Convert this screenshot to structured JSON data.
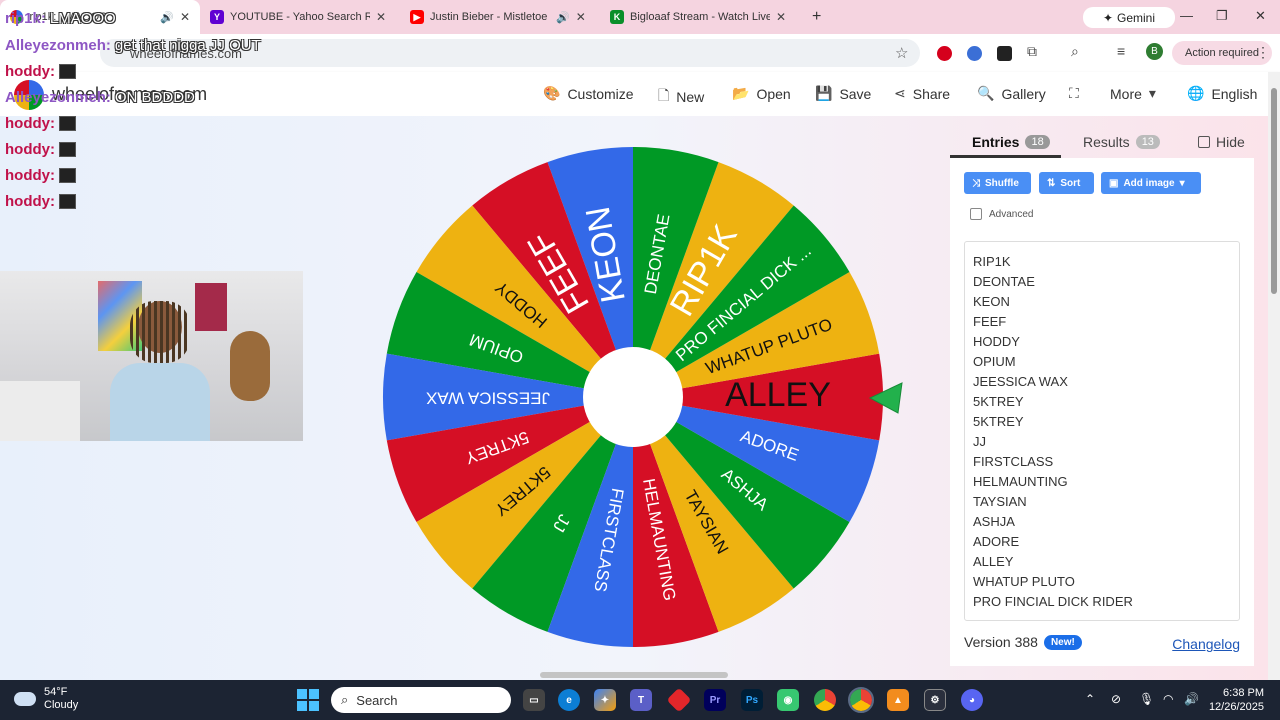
{
  "browser": {
    "tabs": [
      {
        "title": "rip1k: LMAOOO",
        "favicon": "wheel-icon"
      },
      {
        "title": "YOUTUBE - Yahoo Search Results",
        "favicon": "yahoo-icon"
      },
      {
        "title": "Justin Bieber - Mistletoe (Lyrics)",
        "favicon": "youtube-icon"
      },
      {
        "title": "Bigloaaf Stream - Watch Live on Kick",
        "favicon": "kick-icon"
      }
    ],
    "gemini_label": "Gemini",
    "url": "wheelofnames.com",
    "action_required": "Action required",
    "profile_initial": "B"
  },
  "site": {
    "name": "wheelofnames.com",
    "nav": [
      "Customize",
      "New",
      "Open",
      "Save",
      "Share",
      "Gallery",
      "More",
      "English"
    ]
  },
  "wheel": {
    "colors": [
      "#3369e8",
      "#d50f25",
      "#eeb211",
      "#009925"
    ],
    "segments": [
      "RIP1K",
      "DEONTAE",
      "KEON",
      "FEEF",
      "HODDY",
      "OPIUM",
      "JEESSICA WAX",
      "5KTREY",
      "5KTREY",
      "JJ",
      "FIRSTCLASS",
      "HELMAUNTING",
      "TAYSIAN",
      "ASHJA",
      "ADORE",
      "ALLEY",
      "WHATUP PLUTO",
      "PRO FINCIAL DICK ..."
    ],
    "winner": "ALLEY"
  },
  "panel": {
    "tab_entries": "Entries",
    "entries_count": "18",
    "tab_results": "Results",
    "results_count": "13",
    "hide_label": "Hide",
    "shuffle_label": "Shuffle",
    "sort_label": "Sort",
    "add_image_label": "Add image",
    "advanced_label": "Advanced",
    "entries": [
      "RIP1K",
      "DEONTAE",
      "KEON",
      "FEEF",
      "HODDY",
      "OPIUM",
      "JEESSICA WAX",
      "5KTREY",
      "5KTREY",
      "JJ",
      "FIRSTCLASS",
      "HELMAUNTING",
      "TAYSIAN",
      "ASHJA",
      "ADORE",
      "ALLEY",
      "WHATUP PLUTO",
      "PRO FINCIAL DICK RIDER"
    ],
    "version": "Version 388",
    "new_badge": "New!",
    "changelog": "Changelog"
  },
  "chat": [
    {
      "user": "rip1k:",
      "message": "LMAOOO",
      "purple": true
    },
    {
      "user": "Alleyezonmeh:",
      "message": "get that nigga JJ OUT",
      "purple": true
    },
    {
      "user": "hoddy:",
      "message": "",
      "purple": false
    },
    {
      "user": "Alleyezonmeh:",
      "message": "ON BDDDD",
      "purple": true
    },
    {
      "user": "hoddy:",
      "message": "",
      "purple": false
    },
    {
      "user": "hoddy:",
      "message": "",
      "purple": false
    },
    {
      "user": "hoddy:",
      "message": "",
      "purple": false
    },
    {
      "user": "hoddy:",
      "message": "",
      "purple": false
    }
  ],
  "taskbar": {
    "temperature": "54°F",
    "condition": "Cloudy",
    "search_placeholder": "Search",
    "time": "6:38 PM",
    "date": "12/26/2025"
  }
}
